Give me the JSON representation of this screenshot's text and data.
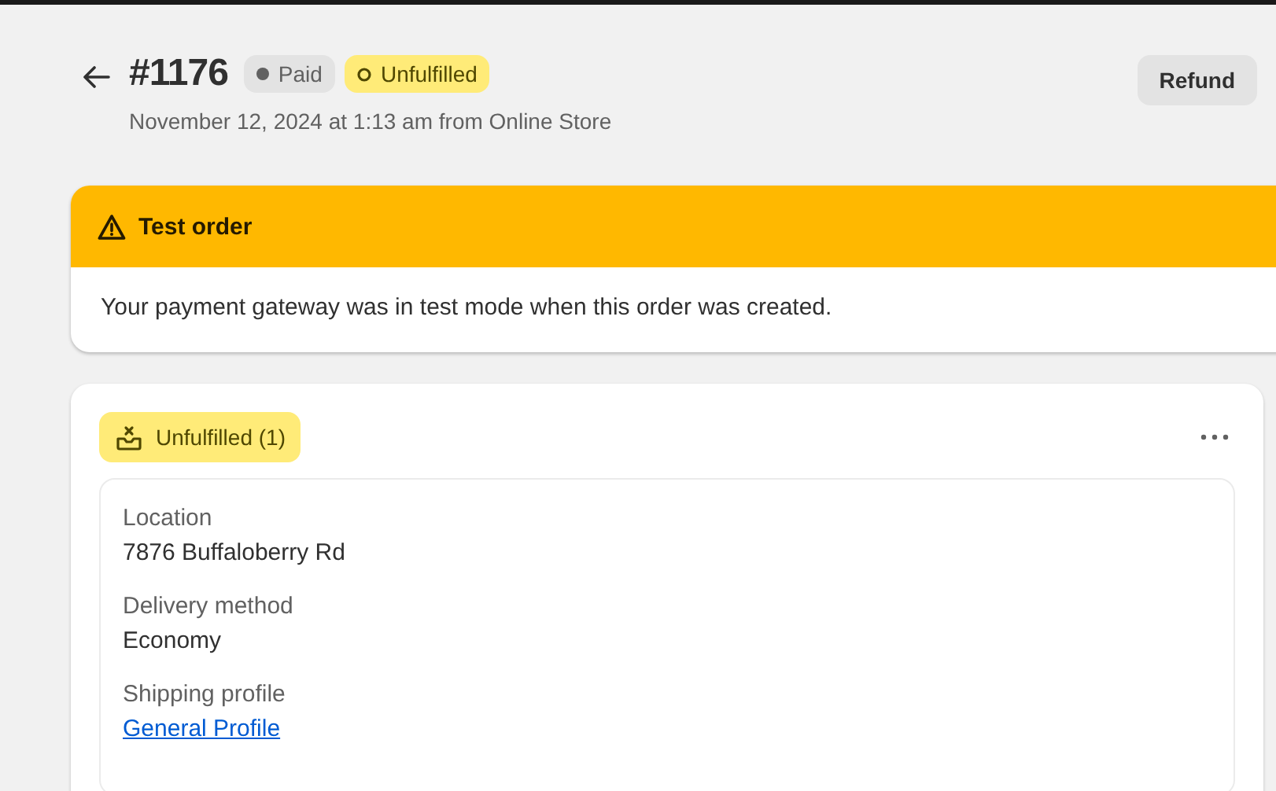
{
  "header": {
    "title": "#1176",
    "badges": [
      {
        "label": "Paid",
        "kind": "payment"
      },
      {
        "label": "Unfulfilled",
        "kind": "fulfillment"
      }
    ],
    "subtitle": "November 12, 2024 at 1:13 am from Online Store",
    "actions": [
      "Refund"
    ]
  },
  "banner": {
    "title": "Test order",
    "message": "Your payment gateway was in test mode when this order was created."
  },
  "fulfillment": {
    "badge": "Unfulfilled (1)",
    "fields": [
      {
        "label": "Location",
        "value": "7876 Buffaloberry Rd",
        "kind": "text"
      },
      {
        "label": "Delivery method",
        "value": "Economy",
        "kind": "text"
      },
      {
        "label": "Shipping profile",
        "value": "General Profile",
        "kind": "link"
      }
    ]
  }
}
